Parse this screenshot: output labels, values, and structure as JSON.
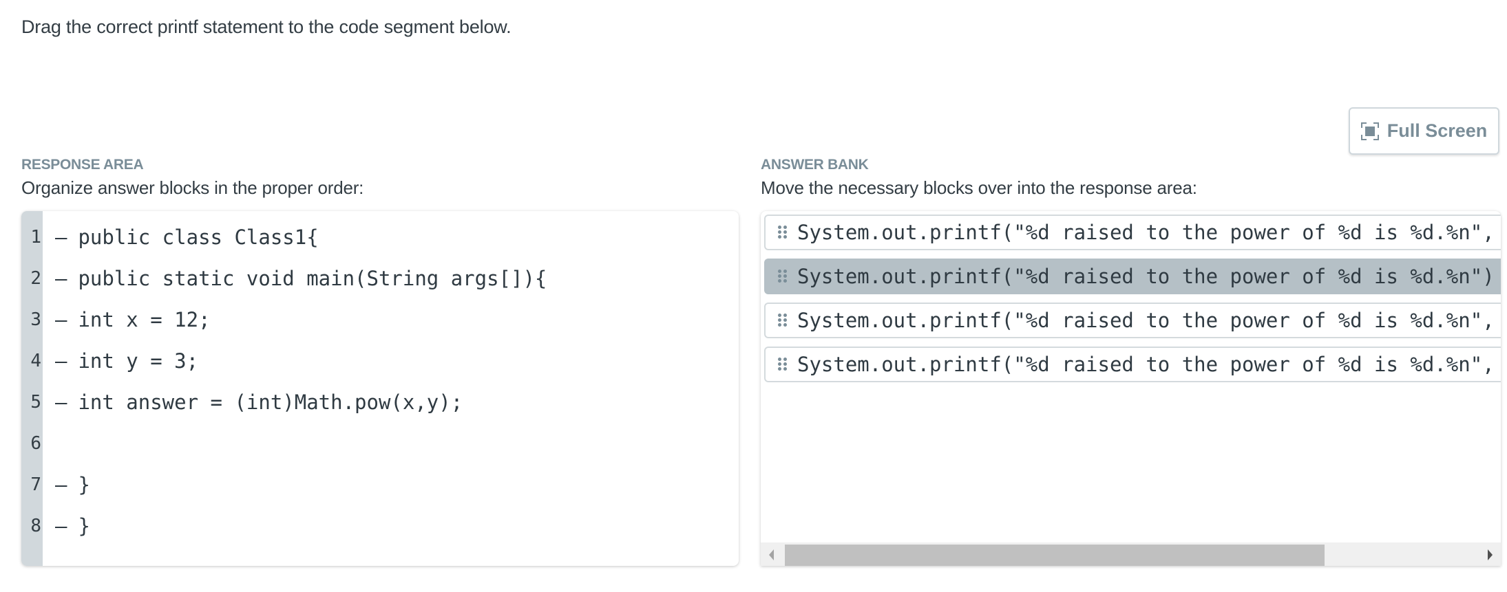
{
  "prompt": "Drag the correct printf statement to the code segment below.",
  "full_screen": {
    "label": "Full Screen",
    "icon": "fullscreen-icon"
  },
  "response_area": {
    "title": "RESPONSE AREA",
    "subtitle": "Organize answer blocks in the proper order:",
    "lines": [
      {
        "num": "1",
        "dash": "–",
        "code": "public class Class1{"
      },
      {
        "num": "2",
        "dash": "–",
        "code": "public static void main(String args[]){"
      },
      {
        "num": "3",
        "dash": "–",
        "code": "int x = 12;"
      },
      {
        "num": "4",
        "dash": "–",
        "code": "int y = 3;"
      },
      {
        "num": "5",
        "dash": "–",
        "code": "int answer = (int)Math.pow(x,y);"
      },
      {
        "num": "6",
        "dash": "",
        "code": ""
      },
      {
        "num": "7",
        "dash": "–",
        "code": "}"
      },
      {
        "num": "8",
        "dash": "–",
        "code": "}"
      }
    ]
  },
  "answer_bank": {
    "title": "ANSWER BANK",
    "subtitle": "Move the necessary blocks over into the response area:",
    "blocks": [
      {
        "text": "System.out.printf(\"%d raised to the power of %d is %d.%n\",",
        "selected": false
      },
      {
        "text": "System.out.printf(\"%d raised to the power of %d is %d.%n\")",
        "selected": true
      },
      {
        "text": "System.out.printf(\"%d raised to the power of %d is %d.%n\",",
        "selected": false
      },
      {
        "text": "System.out.printf(\"%d raised to the power of %d is %d.%n\",",
        "selected": false
      }
    ],
    "scrollbar": {
      "position_fraction": 0.0,
      "visible_fraction": 0.78
    }
  },
  "colors": {
    "accent_gray": "#7a8d98",
    "gutter": "#d1d8dc",
    "selected_block": "#b5c0c6"
  }
}
